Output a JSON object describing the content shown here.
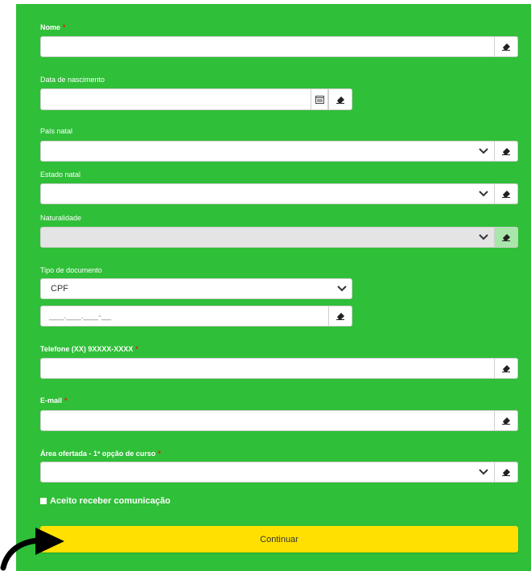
{
  "form": {
    "nome": {
      "label": "Nome",
      "required_mark": "*",
      "value": ""
    },
    "data_nascimento": {
      "label": "Data de nascimento",
      "value": ""
    },
    "pais_natal": {
      "label": "País natal",
      "value": ""
    },
    "estado_natal": {
      "label": "Estado natal",
      "value": ""
    },
    "naturalidade": {
      "label": "Naturalidade",
      "value": ""
    },
    "tipo_documento": {
      "label": "Tipo de documento",
      "value": "CPF"
    },
    "documento": {
      "mask": "___.___.___-__"
    },
    "telefone": {
      "label": "Telefone (XX) 9XXXX-XXXX",
      "required_mark": "*",
      "value": ""
    },
    "email": {
      "label": "E-mail",
      "required_mark": "*",
      "value": ""
    },
    "area": {
      "label": "Área ofertada - 1ª opção de curso",
      "required_mark": "*",
      "value": ""
    },
    "consent": {
      "label": "Aceito receber comunicação"
    },
    "submit_label": "Continuar"
  },
  "colors": {
    "panel": "#2fbf38",
    "button": "#ffe000",
    "required": "#e02020"
  },
  "icons": {
    "eraser": "eraser-icon",
    "calendar": "calendar-icon",
    "chevron": "chevron-down-icon",
    "pointer": "curved-arrow-icon"
  }
}
